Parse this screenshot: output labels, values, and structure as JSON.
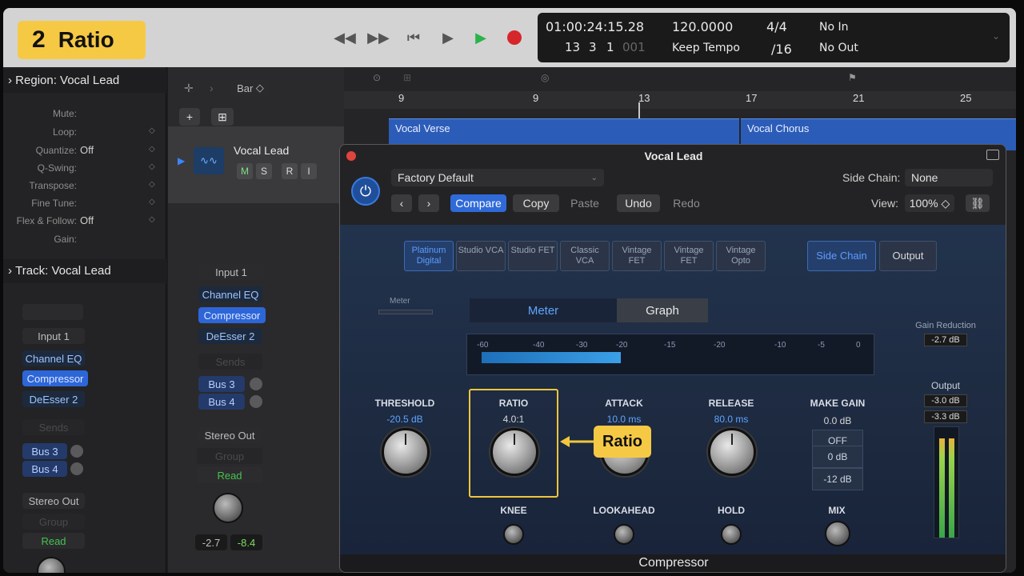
{
  "step": {
    "number": "2",
    "title": "Ratio"
  },
  "lcd": {
    "timecode": "01:00:24:15.28",
    "bars": [
      "13",
      "3",
      "1",
      "001"
    ],
    "tempo": "120.0000",
    "tempo_mode": "Keep Tempo",
    "signature": "4/4",
    "division": "/16",
    "midi_in": "No In",
    "midi_out": "No Out"
  },
  "inspector": {
    "region_header": "Region: Vocal Lead",
    "region_params": [
      {
        "label": "Mute:",
        "value": ""
      },
      {
        "label": "Loop:",
        "value": ""
      },
      {
        "label": "Quantize:",
        "value": "Off"
      },
      {
        "label": "Q-Swing:",
        "value": ""
      },
      {
        "label": "Transpose:",
        "value": ""
      },
      {
        "label": "Fine Tune:",
        "value": ""
      },
      {
        "label": "Flex & Follow:",
        "value": "Off"
      },
      {
        "label": "Gain:",
        "value": ""
      }
    ],
    "track_header": "Track: Vocal Lead",
    "strip": {
      "input": "Input 1",
      "plugins": [
        "Channel EQ",
        "Compressor",
        "DeEsser 2"
      ],
      "sends_label": "Sends",
      "buses": [
        "Bus 3",
        "Bus 4"
      ],
      "output": "Stereo Out",
      "group": "Group",
      "automation": "Read"
    }
  },
  "trackcol": {
    "snap": "Bar",
    "track_name": "Vocal Lead",
    "buttons": [
      "M",
      "S",
      "R",
      "I"
    ],
    "strip": {
      "input": "Input 1",
      "plugins": [
        "Channel EQ",
        "Compressor",
        "DeEsser 2"
      ],
      "sends_label": "Sends",
      "buses": [
        "Bus 3",
        "Bus 4"
      ],
      "output": "Stereo Out",
      "group": "Group",
      "automation": "Read",
      "volume": "-2.7",
      "peak": "-8.4"
    }
  },
  "arrange": {
    "bars": [
      "9",
      "9",
      "13",
      "17",
      "21",
      "25"
    ],
    "regions": [
      "Vocal Verse",
      "Vocal Chorus"
    ]
  },
  "plugin": {
    "window_title": "Vocal Lead",
    "preset": "Factory Default",
    "buttons": {
      "compare": "Compare",
      "copy": "Copy",
      "paste": "Paste",
      "undo": "Undo",
      "redo": "Redo"
    },
    "side_chain_label": "Side Chain:",
    "side_chain_value": "None",
    "view_label": "View:",
    "view_value": "100%",
    "models": [
      "Platinum Digital",
      "Studio VCA",
      "Studio FET",
      "Classic VCA",
      "Vintage FET",
      "Vintage FET",
      "Vintage Opto"
    ],
    "side_chain_btn": "Side Chain",
    "output_btn": "Output",
    "meter_small_label": "Meter",
    "tabs": {
      "meter": "Meter",
      "graph": "Graph"
    },
    "meter_scale": [
      "-60",
      "-40",
      "-30",
      "-20",
      "-15",
      "-20",
      "-10",
      "-5",
      "0"
    ],
    "threshold": {
      "label": "THRESHOLD",
      "value": "-20.5 dB"
    },
    "ratio": {
      "label": "RATIO",
      "value": "4.0:1"
    },
    "attack": {
      "label": "ATTACK",
      "value": "10.0 ms"
    },
    "release": {
      "label": "RELEASE",
      "value": "80.0 ms"
    },
    "makeup": {
      "label": "MAKE GAIN",
      "value": "0.0 dB",
      "buttons": [
        "OFF",
        "0 dB",
        "-12 dB"
      ]
    },
    "knee": {
      "label": "KNEE"
    },
    "lookahead": {
      "label": "LOOKAHEAD"
    },
    "hold": {
      "label": "HOLD"
    },
    "mix": {
      "label": "MIX"
    },
    "gain_reduction": {
      "label": "Gain Reduction",
      "value": "-2.7 dB"
    },
    "output": {
      "label": "Output",
      "left": "-3.0 dB",
      "right": "-3.3 dB"
    },
    "footer": "Compressor"
  },
  "callout": {
    "text": "Ratio"
  },
  "colors": {
    "accent": "#f6c945",
    "blue": "#2f6ad8",
    "meter": "#3aa0e8"
  }
}
